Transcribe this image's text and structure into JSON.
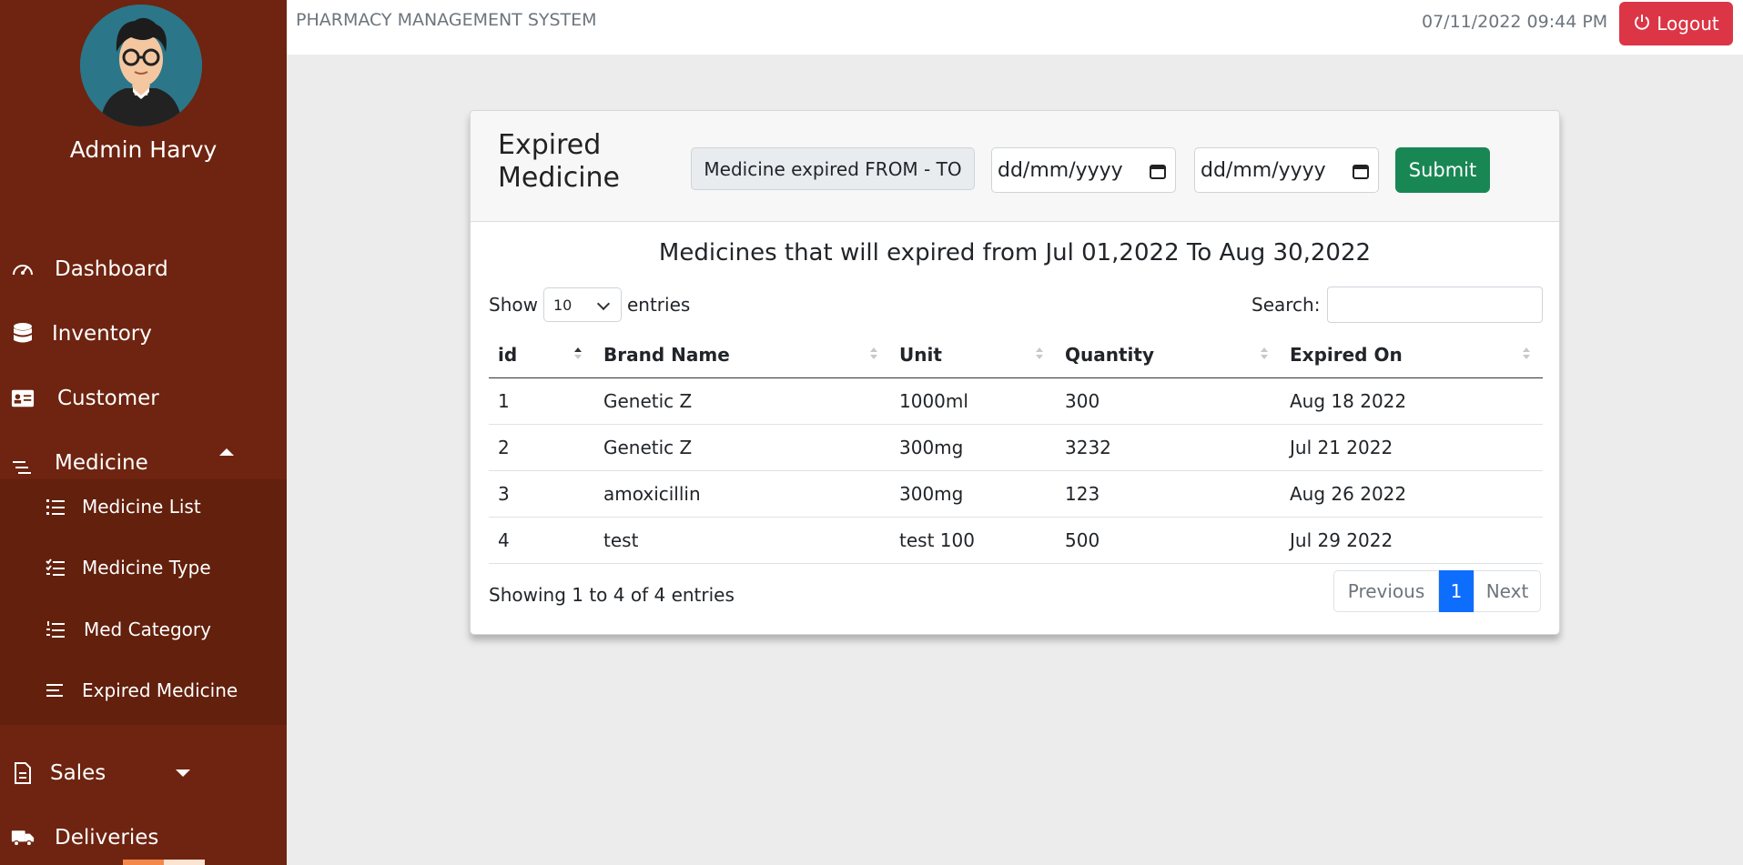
{
  "header": {
    "system_title": "PHARMACY MANAGEMENT SYSTEM",
    "datetime": "07/11/2022 09:44 PM",
    "logout_label": "Logout"
  },
  "sidebar": {
    "user_name": "Admin Harvy",
    "items": [
      {
        "label": "Dashboard",
        "icon": "speedometer-icon"
      },
      {
        "label": "Inventory",
        "icon": "database-icon"
      },
      {
        "label": "Customer",
        "icon": "id-card-icon"
      },
      {
        "label": "Medicine",
        "icon": "menu-lines-icon",
        "expanded": true
      },
      {
        "label": "Sales",
        "icon": "receipt-icon"
      },
      {
        "label": "Deliveries",
        "icon": "truck-icon"
      }
    ],
    "submenu": [
      {
        "label": "Medicine List",
        "icon": "list-icon"
      },
      {
        "label": "Medicine Type",
        "icon": "checklist-icon"
      },
      {
        "label": "Med Category",
        "icon": "numbered-list-icon"
      },
      {
        "label": "Expired Medicine",
        "icon": "align-icon"
      }
    ]
  },
  "card": {
    "title": "Expired Medicine",
    "range_label": "Medicine expired FROM - TO",
    "date_from_placeholder": "dd/mm/yyyy",
    "date_to_placeholder": "dd/mm/yyyy",
    "submit_label": "Submit",
    "result_heading": "Medicines that will expired from Jul 01,2022 To Aug 30,2022",
    "show_label": "Show",
    "entries_value": "10",
    "entries_label": "entries",
    "search_label": "Search:",
    "columns": [
      "id",
      "Brand Name",
      "Unit",
      "Quantity",
      "Expired On"
    ],
    "rows": [
      [
        "1",
        "Genetic Z",
        "1000ml",
        "300",
        "Aug 18 2022"
      ],
      [
        "2",
        "Genetic Z",
        "300mg",
        "3232",
        "Jul 21 2022"
      ],
      [
        "3",
        "amoxicillin",
        "300mg",
        "123",
        "Aug 26 2022"
      ],
      [
        "4",
        "test",
        "test 100",
        "500",
        "Jul 29 2022"
      ]
    ],
    "info": "Showing 1 to 4 of 4 entries",
    "pagination": {
      "previous": "Previous",
      "current": "1",
      "next": "Next"
    }
  },
  "colors": {
    "sidebar": "#6e2410",
    "submenu": "#62200d",
    "logout": "#dc3545",
    "submit": "#198754",
    "page_active": "#0d6efd"
  }
}
